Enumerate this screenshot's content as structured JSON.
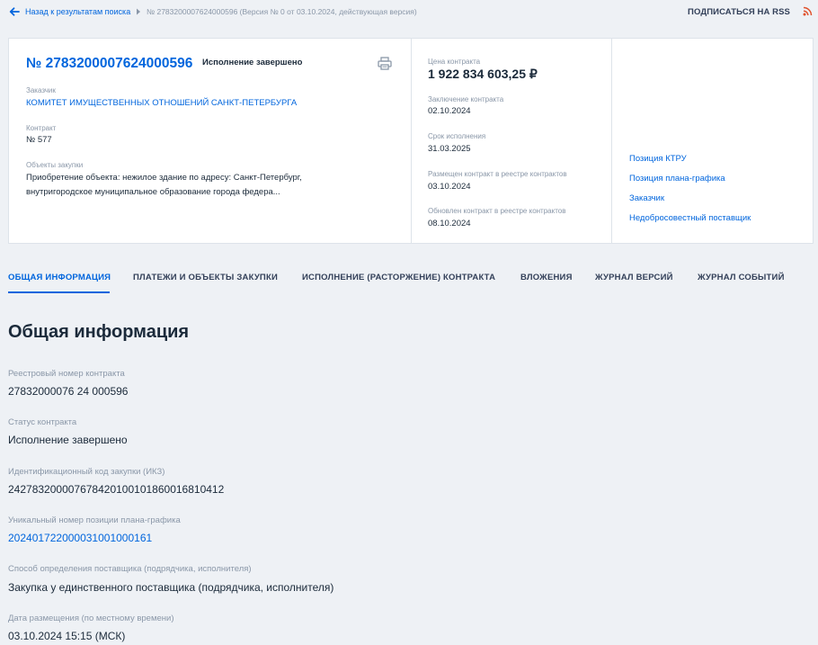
{
  "breadcrumb": {
    "back_label": "Назад к результатам поиска",
    "current": "№ 2783200007624000596 (Версия № 0 от 03.10.2024, действующая версия)"
  },
  "header": {
    "rss_label": "ПОДПИСАТЬСЯ НА RSS"
  },
  "card": {
    "reg_number": "№ 2783200007624000596",
    "status": "Исполнение завершено",
    "customer_label": "Заказчик",
    "customer": "КОМИТЕТ ИМУЩЕСТВЕННЫХ ОТНОШЕНИЙ САНКТ-ПЕТЕРБУРГА",
    "contract_label": "Контракт",
    "contract": "№ 577",
    "objects_label": "Объекты закупки",
    "objects": "Приобретение объекта: нежилое здание по адресу: Санкт-Петербург, внутригородское муниципальное образование города федера...",
    "price_label": "Цена контракта",
    "price": "1 922 834 603,25 ₽",
    "conclusion_label": "Заключение контракта",
    "conclusion": "02.10.2024",
    "execution_label": "Срок исполнения",
    "execution": "31.03.2025",
    "placed_label": "Размещен контракт в реестре контрактов",
    "placed": "03.10.2024",
    "updated_label": "Обновлен контракт в реестре контрактов",
    "updated": "08.10.2024",
    "side_links": [
      "Позиция КТРУ",
      "Позиция плана-графика",
      "Заказчик",
      "Недобросовестный поставщик"
    ]
  },
  "tabs": [
    "ОБЩАЯ ИНФОРМАЦИЯ",
    "ПЛАТЕЖИ И ОБЪЕКТЫ ЗАКУПКИ",
    "ИСПОЛНЕНИЕ (РАСТОРЖЕНИЕ) КОНТРАКТА",
    "ВЛОЖЕНИЯ",
    "ЖУРНАЛ ВЕРСИЙ",
    "ЖУРНАЛ СОБЫТИЙ"
  ],
  "main": {
    "title": "Общая информация",
    "fields": [
      {
        "label": "Реестровый номер контракта",
        "value": "27832000076 24 000596"
      },
      {
        "label": "Статус контракта",
        "value": "Исполнение завершено"
      },
      {
        "label": "Идентификационный код закупки (ИКЗ)",
        "value": "242783200007678420100101860016810412"
      },
      {
        "label": "Уникальный номер позиции плана-графика",
        "value": "202401722000031001000161"
      },
      {
        "label": "Способ определения поставщика (подрядчика, исполнителя)",
        "value": "Закупка у единственного поставщика (подрядчика, исполнителя)"
      },
      {
        "label": "Дата размещения (по местному времени)",
        "value": "03.10.2024 15:15 (МСК)"
      }
    ]
  },
  "colors": {
    "accent": "#0065dd",
    "rss": "#e0522d",
    "text": "#1b2a3a",
    "muted": "#8a97a8"
  }
}
